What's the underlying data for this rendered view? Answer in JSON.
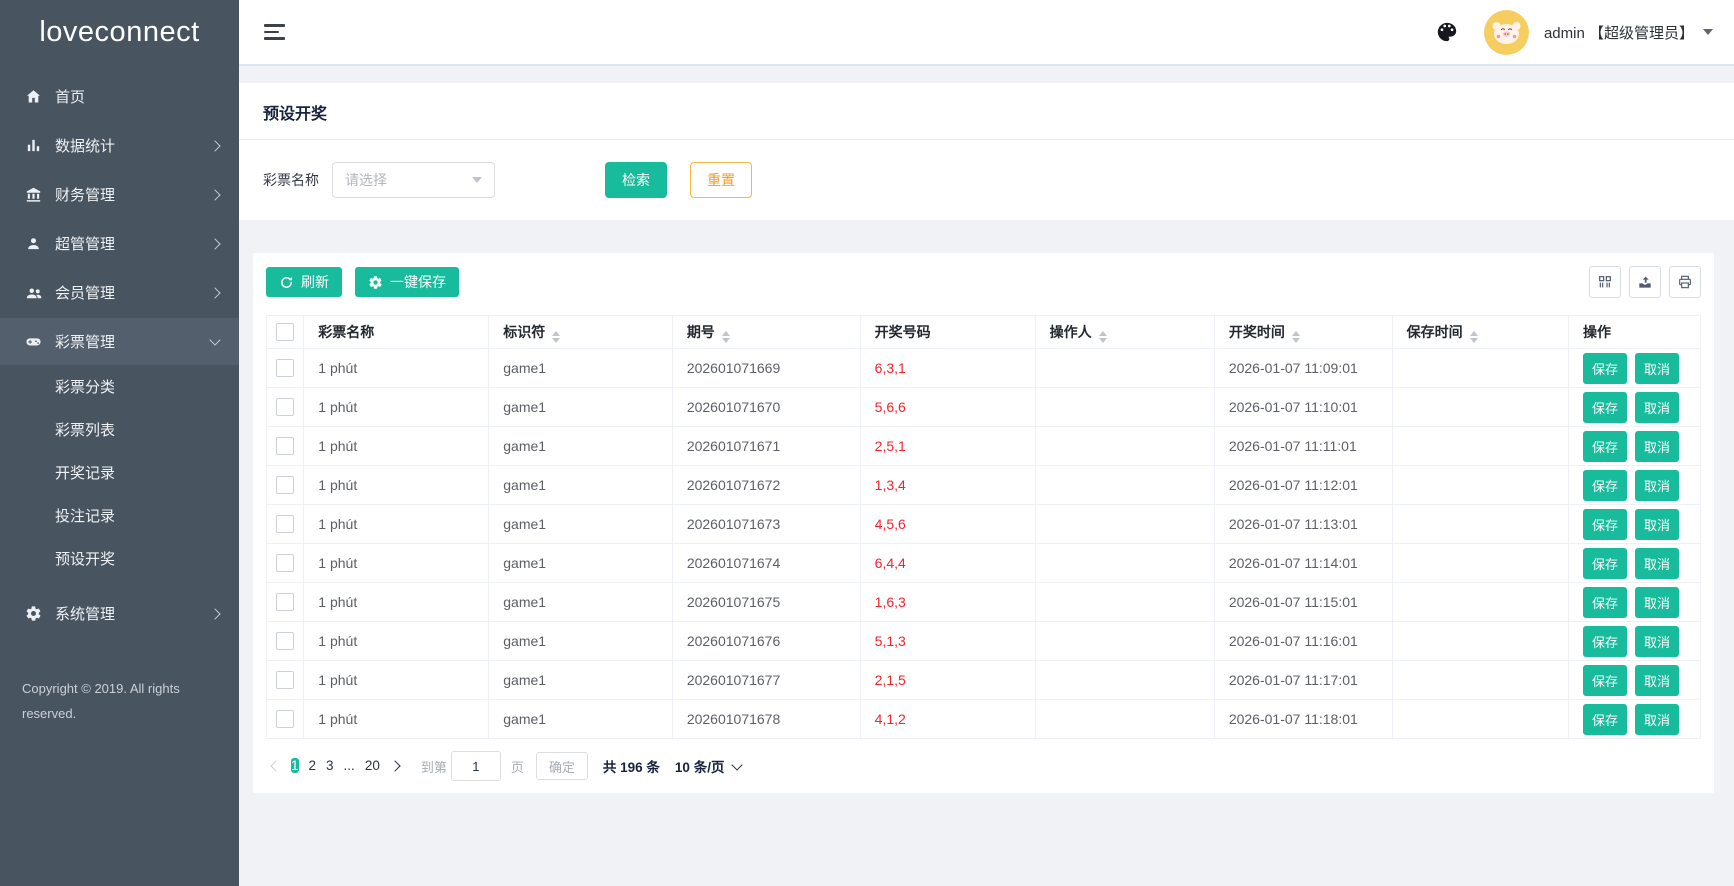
{
  "colors": {
    "accent_teal": "#18bc9c",
    "reset_border": "#f5b840",
    "reset_text": "#f59a23",
    "draw_number_red": "#f5222d",
    "sidebar_bg": "#495461",
    "sidebar_active_bg": "#545f6d",
    "avatar_bg": "#f6ce5f"
  },
  "sidebar": {
    "logo": "loveconnect",
    "menu": [
      {
        "key": "home",
        "label": "首页",
        "icon": "home-icon",
        "expandable": false,
        "expanded": false,
        "active": false
      },
      {
        "key": "stats",
        "label": "数据统计",
        "icon": "bar-chart-icon",
        "expandable": true,
        "expanded": false,
        "active": false
      },
      {
        "key": "finance",
        "label": "财务管理",
        "icon": "bank-icon",
        "expandable": true,
        "expanded": false,
        "active": false
      },
      {
        "key": "super-admin",
        "label": "超管管理",
        "icon": "user-icon",
        "expandable": true,
        "expanded": false,
        "active": false
      },
      {
        "key": "member",
        "label": "会员管理",
        "icon": "users-icon",
        "expandable": true,
        "expanded": false,
        "active": false
      },
      {
        "key": "lottery",
        "label": "彩票管理",
        "icon": "gamepad-icon",
        "expandable": true,
        "expanded": true,
        "active": true
      },
      {
        "key": "system",
        "label": "系统管理",
        "icon": "gear-icon",
        "expandable": true,
        "expanded": false,
        "active": false
      }
    ],
    "submenu": [
      {
        "key": "lottery-category",
        "label": "彩票分类"
      },
      {
        "key": "lottery-list",
        "label": "彩票列表"
      },
      {
        "key": "draw-records",
        "label": "开奖记录"
      },
      {
        "key": "bet-records",
        "label": "投注记录"
      },
      {
        "key": "preset-draw",
        "label": "预设开奖"
      }
    ],
    "copyright": "Copyright © 2019. All rights reserved."
  },
  "topbar": {
    "username": "admin 【超级管理员】"
  },
  "page": {
    "title": "预设开奖"
  },
  "filter": {
    "label": "彩票名称",
    "placeholder": "请选择",
    "search": "检索",
    "reset": "重置"
  },
  "toolbar": {
    "refresh": "刷新",
    "save_all": "一键保存",
    "icons": [
      "columns-icon",
      "export-icon",
      "print-icon"
    ]
  },
  "table": {
    "columns": [
      {
        "key": "name",
        "label": "彩票名称",
        "sortable": false
      },
      {
        "key": "code",
        "label": "标识符",
        "sortable": true
      },
      {
        "key": "issue",
        "label": "期号",
        "sortable": true
      },
      {
        "key": "numbers",
        "label": "开奖号码",
        "sortable": false
      },
      {
        "key": "operator",
        "label": "操作人",
        "sortable": true
      },
      {
        "key": "draw_time",
        "label": "开奖时间",
        "sortable": true
      },
      {
        "key": "save_time",
        "label": "保存时间",
        "sortable": true
      },
      {
        "key": "ops",
        "label": "操作",
        "sortable": false
      }
    ],
    "rows": [
      {
        "name": "1 phút",
        "code": "game1",
        "issue": "202601071669",
        "numbers": "6,3,1",
        "operator": "",
        "draw_time": "2026-01-07 11:09:01",
        "save_time": ""
      },
      {
        "name": "1 phút",
        "code": "game1",
        "issue": "202601071670",
        "numbers": "5,6,6",
        "operator": "",
        "draw_time": "2026-01-07 11:10:01",
        "save_time": ""
      },
      {
        "name": "1 phút",
        "code": "game1",
        "issue": "202601071671",
        "numbers": "2,5,1",
        "operator": "",
        "draw_time": "2026-01-07 11:11:01",
        "save_time": ""
      },
      {
        "name": "1 phút",
        "code": "game1",
        "issue": "202601071672",
        "numbers": "1,3,4",
        "operator": "",
        "draw_time": "2026-01-07 11:12:01",
        "save_time": ""
      },
      {
        "name": "1 phút",
        "code": "game1",
        "issue": "202601071673",
        "numbers": "4,5,6",
        "operator": "",
        "draw_time": "2026-01-07 11:13:01",
        "save_time": ""
      },
      {
        "name": "1 phút",
        "code": "game1",
        "issue": "202601071674",
        "numbers": "6,4,4",
        "operator": "",
        "draw_time": "2026-01-07 11:14:01",
        "save_time": ""
      },
      {
        "name": "1 phút",
        "code": "game1",
        "issue": "202601071675",
        "numbers": "1,6,3",
        "operator": "",
        "draw_time": "2026-01-07 11:15:01",
        "save_time": ""
      },
      {
        "name": "1 phút",
        "code": "game1",
        "issue": "202601071676",
        "numbers": "5,1,3",
        "operator": "",
        "draw_time": "2026-01-07 11:16:01",
        "save_time": ""
      },
      {
        "name": "1 phút",
        "code": "game1",
        "issue": "202601071677",
        "numbers": "2,1,5",
        "operator": "",
        "draw_time": "2026-01-07 11:17:01",
        "save_time": ""
      },
      {
        "name": "1 phút",
        "code": "game1",
        "issue": "202601071678",
        "numbers": "4,1,2",
        "operator": "",
        "draw_time": "2026-01-07 11:18:01",
        "save_time": ""
      }
    ],
    "row_actions": {
      "save": "保存",
      "cancel": "取消"
    }
  },
  "pagination": {
    "pages": [
      "1",
      "2",
      "3",
      "...",
      "20"
    ],
    "active_page": "1",
    "goto_label": "到第",
    "goto_value": "1",
    "page_label": "页",
    "confirm": "确定",
    "total": "共 196 条",
    "page_size": "10 条/页"
  }
}
